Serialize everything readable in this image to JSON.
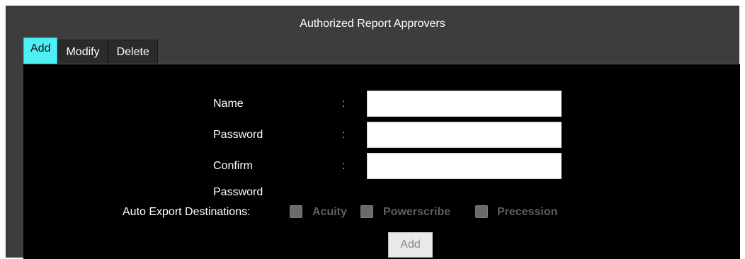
{
  "dialog": {
    "title": "Authorized Report Approvers"
  },
  "tabs": [
    {
      "label": "Add",
      "active": true
    },
    {
      "label": "Modify",
      "active": false
    },
    {
      "label": "Delete",
      "active": false
    }
  ],
  "form": {
    "name_label": "Name",
    "password_label": "Password",
    "confirm_password_label": "Confirm Password",
    "separator": ":",
    "name_value": "",
    "password_value": "",
    "confirm_password_value": ""
  },
  "export": {
    "label": "Auto Export Destinations:",
    "options": [
      {
        "label": "Acuity",
        "checked": false,
        "enabled": false
      },
      {
        "label": "Powerscribe",
        "checked": false,
        "enabled": false
      },
      {
        "label": "Precession",
        "checked": false,
        "enabled": false
      }
    ]
  },
  "actions": {
    "add_label": "Add",
    "add_enabled": false
  },
  "colors": {
    "active_tab": "#4cf0f5",
    "panel_bg": "#000000",
    "window_bg": "#3d3d3d"
  }
}
